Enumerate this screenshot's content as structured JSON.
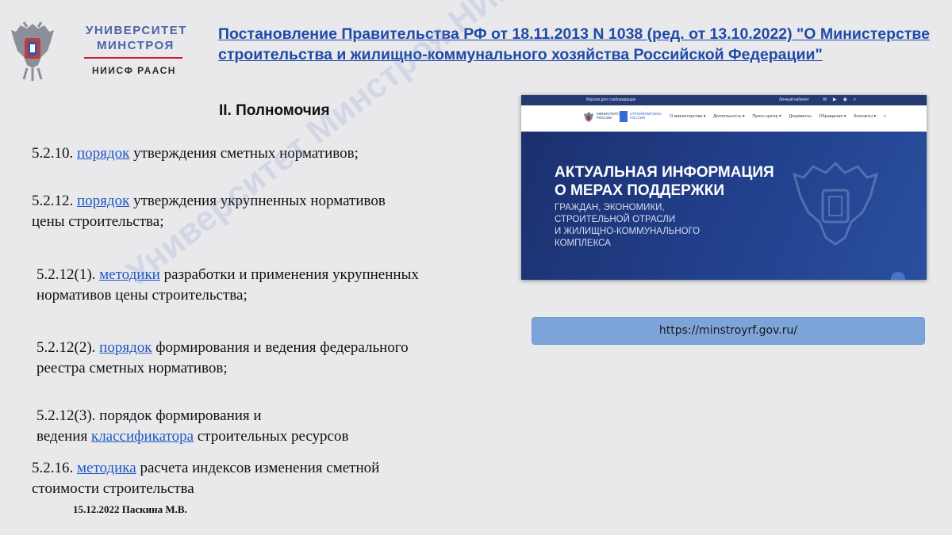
{
  "logo": {
    "line1": "УНИВЕРСИТЕТ",
    "line2": "МИНСТРОЯ",
    "line3": "НИИСФ РААСН"
  },
  "title": "Постановление Правительства РФ от 18.11.2013 N 1038 (ред. от 13.10.2022) \"О Министерстве строительства и жилищно-коммунального хозяйства Российской Федерации\"",
  "section_heading": "II. Полномочия",
  "items": [
    {
      "prefix": "5.2.10. ",
      "link": "порядок",
      "text_line1": " утверждения сметных нормативов;",
      "text_line2": ""
    },
    {
      "prefix": "5.2.12. ",
      "link": "порядок",
      "text_line1": " утверждения укрупненных нормативов",
      "text_line2": "цены строительства;"
    },
    {
      "prefix": "5.2.12(1). ",
      "link": "методики",
      "text_line1": " разработки и применения укрупненных",
      "text_line2": "нормативов цены строительства;"
    },
    {
      "prefix": "5.2.12(2). ",
      "link": "порядок",
      "text_line1": " формирования и ведения федерального",
      "text_line2": "реестра сметных нормативов;"
    },
    {
      "prefix_line1": "5.2.12(3). порядок формирования и",
      "prefix_line2": "ведения ",
      "link": "классификатора",
      "text_line2": " строительных ресурсов"
    },
    {
      "prefix": "5.2.16. ",
      "link": "методика",
      "text_line1": " расчета индексов изменения сметной",
      "text_line2": "стоимости строительства"
    }
  ],
  "footer": "15.12.2022 Паскина М.В.",
  "watermark": "Университет Минстроя НИИСФ РААСН Паскина М.В.",
  "screenshot": {
    "topbar_left": "Версия для слабовидящих",
    "topbar_right": "Личный кабинет",
    "topbar_icons": "✉ ▶ ◉ ⌕",
    "brand1": "МИНИСТЕРСТВО РОССИИ",
    "brand2": "СТРОЙКОМПЛЕКС РОССИИ",
    "menu": [
      "О министерстве ▾",
      "Деятельность ▾",
      "Пресс-центр ▾",
      "Документы",
      "Обращения ▾",
      "Контакты ▾",
      "⌕"
    ],
    "hero_title_1": "АКТУАЛЬНАЯ ИНФОРМАЦИЯ",
    "hero_title_2": "О МЕРАХ ПОДДЕРЖКИ",
    "hero_sub_1": "ГРАЖДАН, ЭКОНОМИКИ,",
    "hero_sub_2": "СТРОИТЕЛЬНОЙ ОТРАСЛИ",
    "hero_sub_3": "И ЖИЛИЩНО-КОММУНАЛЬНОГО",
    "hero_sub_4": "КОМПЛЕКСА"
  },
  "url": "https://minstroyrf.gov.ru/",
  "colors": {
    "link": "#1f57c4",
    "title": "#1f4aa8",
    "hero": "#22418d",
    "url_bar": "#7da4d8"
  }
}
